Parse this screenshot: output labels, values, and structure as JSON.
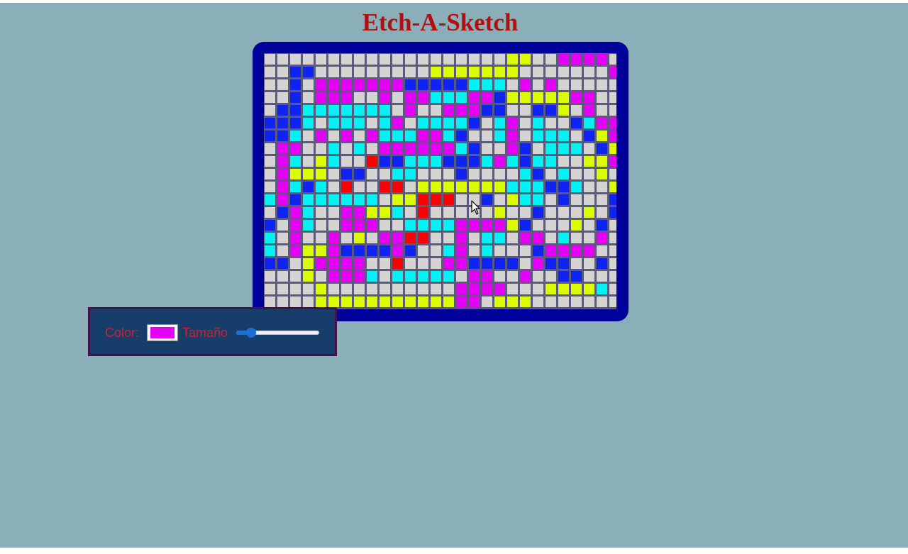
{
  "title": "Etch-A-Sketch",
  "controls": {
    "color_label": "Color:",
    "color_value": "#e400f4",
    "size_label": "Tamaño",
    "size_slider_fraction": 0.18
  },
  "colors": {
    "page_bg": "#8aafb9",
    "title": "#b30f0f",
    "frame": "#00009a",
    "controls_bg": "#173e6a",
    "controls_border": "#42134b",
    "controls_text": "#d0202f"
  },
  "canvas": {
    "palette": {
      ".": "#d6d3d3",
      "M": "#e400f4",
      "C": "#00f2f2",
      "B": "#0f24f2",
      "Y": "#dcfc00",
      "R": "#fb0000"
    },
    "rows": [
      "...................YY..MMMM...",
      "..BB.........YYYYYYY.......MMMMM..",
      "..B.MMMMMMMBBBBBCCC.M.M...",
      "..B.MMM..M.MMCCCMMBYYYYYMM.",
      ".BBCCCCCCC.M..MMMBB..BBY.M.",
      "BBBC.CCC.CM.CCCCB.CM.C..BCMM",
      "BBC.M.M.MCCCMMCB..CM.CCC.BYM",
      ".MM..C.C.MMMMMMCB..MB.CCC.BYMM",
      ".MC.YC..RBBCCCBBBCMCBCC..YYM",
      ".MYYY.BB..CC...B....CB.C..Y..M",
      ".MCBC.R..RR.YYYYYYYCCCBBC..YY..M",
      "CMBCCCCCC.YYRRR..B.YCC.B...B..",
      ".BMC..MMYYC.R.....Y..B...Y.B.M",
      "B.MC..MMM..CCCCMMMMYB...Y.B.M",
      "C.M..M.Y.MMRR..M.CC.MM.C..M",
      "C.MYYMBBBBMB..CM.C...BMMMM..M",
      "BB.YMMMM..R...MMBBBB.MBB..B.C.MM",
      "...Y.MMMC.CCCCC.MM..M..BB...YY.MM",
      "....Y..........MMMM...YYYYC..M",
      "....YYYYYYYYYYYMM.YYY......"
    ]
  }
}
